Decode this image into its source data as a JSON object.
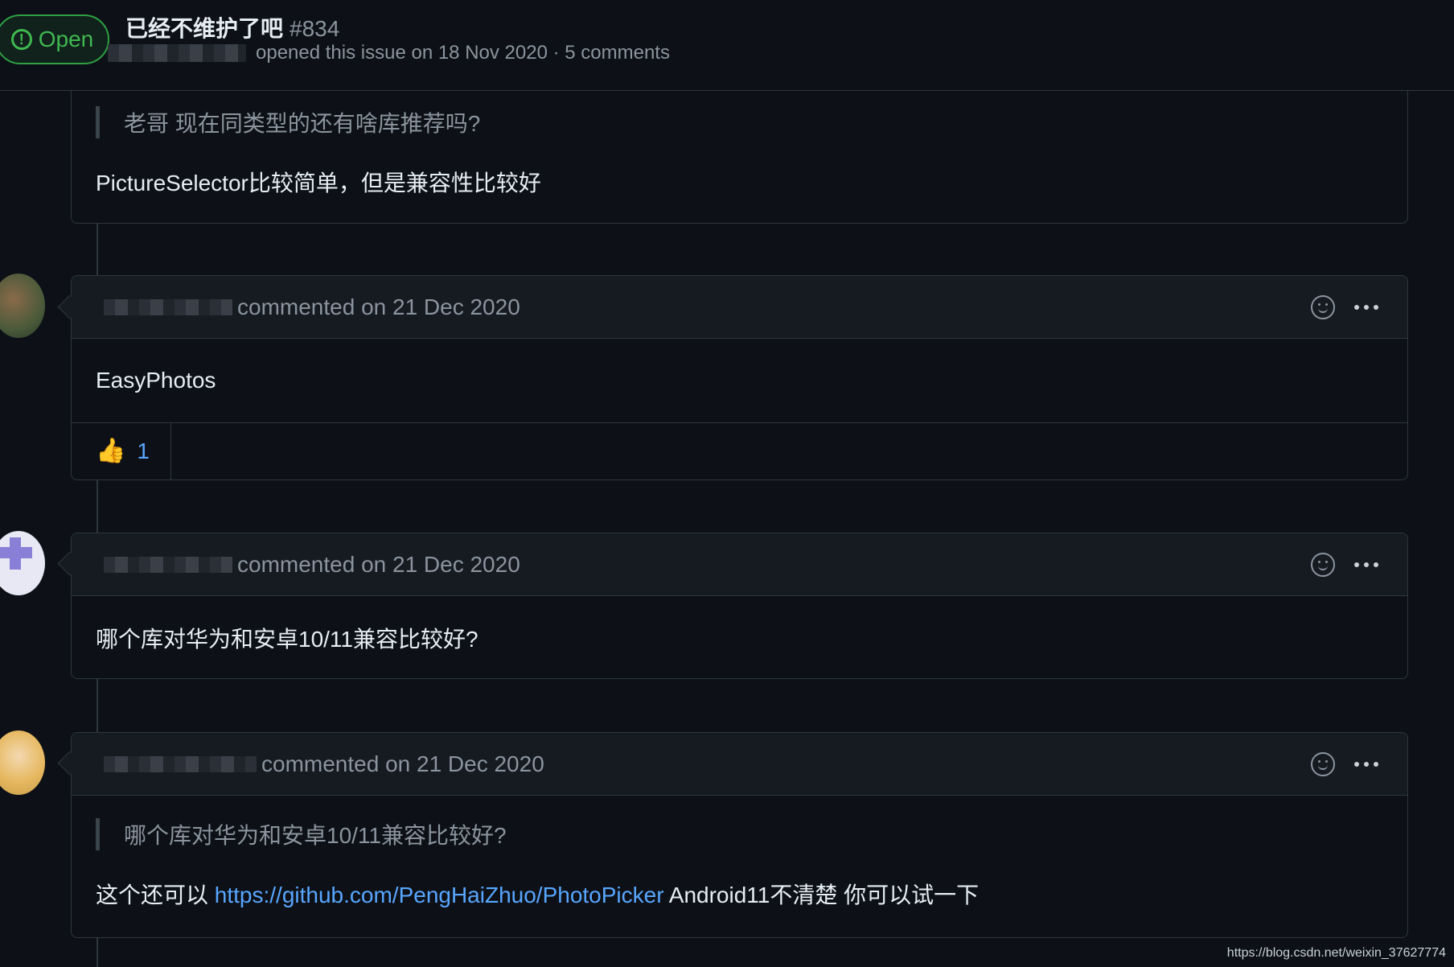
{
  "issue": {
    "state_label": "Open",
    "title": "已经不维护了吧",
    "number": "#834",
    "meta": "opened this issue on 18 Nov 2020 · 5 comments"
  },
  "first_comment": {
    "quote": "老哥 现在同类型的还有啥库推荐吗?",
    "body": "PictureSelector比较简单，但是兼容性比较好"
  },
  "comments": [
    {
      "header_text": "commented on 21 Dec 2020",
      "body": "EasyPhotos",
      "reaction_count": "1"
    },
    {
      "header_text": "commented on 21 Dec 2020",
      "body": "哪个库对华为和安卓10/11兼容比较好?"
    },
    {
      "header_text": "commented on 21 Dec 2020",
      "quote": "哪个库对华为和安卓10/11兼容比较好?",
      "body_prefix": "这个还可以 ",
      "link": "https://github.com/PengHaiZhuo/PhotoPicker",
      "body_suffix": " Android11不清楚 你可以试一下"
    }
  ],
  "icons": {
    "state": "issue-opened-icon",
    "reaction": "smiley-icon",
    "menu": "kebab-horizontal-icon",
    "thumbs": "thumbs-up-icon"
  },
  "colors": {
    "background": "#0d1117",
    "header_bg": "#161b22",
    "border": "#30363d",
    "open_green": "#3fb950",
    "link_blue": "#58a6ff"
  },
  "watermark": "https://blog.csdn.net/weixin_37627774"
}
